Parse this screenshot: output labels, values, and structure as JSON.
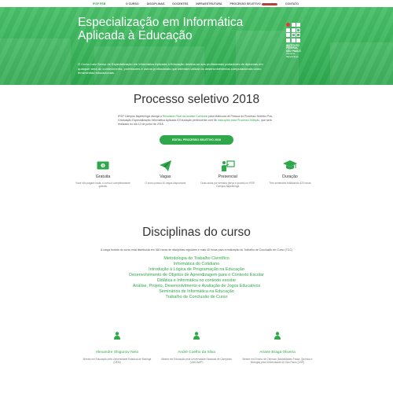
{
  "nav": {
    "brand": "IFSP PEB",
    "links": [
      "O CURSO",
      "DISCIPLINAS",
      "DOCENTES",
      "INFRAESTRUTURA",
      "PROCESSO SELETIVO",
      "CONTATO"
    ],
    "badge": "INSCRIÇÕES"
  },
  "hero": {
    "title": "Especialização em Informática Aplicada à Educação",
    "text": "O Curso Lato Sensu de Especialização em Informática Aplicada à Educação destina-se aos profissionais portadores de diplomas em qualquer área do conhecimento, professores e outros profissionais que intentam utilizar os desenvolvimentos computacionais como ferramentas educacionais.",
    "logo": {
      "line1": "INSTITUTO",
      "line2": "FEDERAL",
      "line3": "SÃO PAULO",
      "line4": "Câmpus",
      "line5": "Itapetininga"
    }
  },
  "processo": {
    "title": "Processo seletivo 2018",
    "text_before": "IFSP Câmpus Itapetininga divulga o ",
    "text_link": "Resultado Final da Análise Curricular",
    "text_mid": " para Matrícula de Pessoa do Processo Seletivo Pós-Graduação Especialização Informática Aplicada À Educação pertencente com de ",
    "text_link2": "Instruções para Processo Seleção",
    "text_after": ", que será realizado no dia 12 de junho de 2018.",
    "button": "EDITAL PROCESSO SELETIVO 2018"
  },
  "features": [
    {
      "icon": "money-icon",
      "label": "Gratuita",
      "text": "Você não pagará nada, o curso é completamente gratuito"
    },
    {
      "icon": "paper-plane-icon",
      "label": "Vagas",
      "text": "O curso possui 40 vagas disponíveis"
    },
    {
      "icon": "presentation-icon",
      "label": "Presencial",
      "text": "Duas aulas por semana (terça e quarta) no IFSP Câmpus Itapetininga"
    },
    {
      "icon": "graduation-cap-icon",
      "label": "Duração",
      "text": "Três semestres totalizando 420 horas"
    }
  ],
  "disciplinas": {
    "title": "Disciplinas do curso",
    "subtitle": "A carga horária do curso está distribuída em 360 horas de disciplinas regulares e mais 40 horas para a realização do Trabalho de Conclusão de Curso (TCC)",
    "items": [
      "Metodologia do Trabalho Científico",
      "Informática do Cotidiano",
      "Introdução à Lógica de Programação na Educação",
      "Desenvolvimento de Objetos de Aprendizagem para o Contexto Escolar",
      "Didática e Informática no contexto escolar",
      "Análise, Projeto, Desenvolvimento e Avaliação de Jogos Educativos",
      "Seminários de Informática na Educação",
      "Trabalho de Conclusão de Curso"
    ]
  },
  "docentes": [
    {
      "name": "Alexandre Shigunov Neto",
      "desc": "Mestre em Educação pela Universidade Estadual de Maringá (UEM)"
    },
    {
      "name": "André Coelho da Silva",
      "desc": "Mestre em Educação pela Universidade Estadual de Campinas (UNICAMP)"
    },
    {
      "name": "Ariane Braga Oliveira",
      "desc": "Mestre em Ensino de Ciências (Modalidades Física, Química e Biologia) pela Universidade de São Paulo (USP)"
    }
  ]
}
